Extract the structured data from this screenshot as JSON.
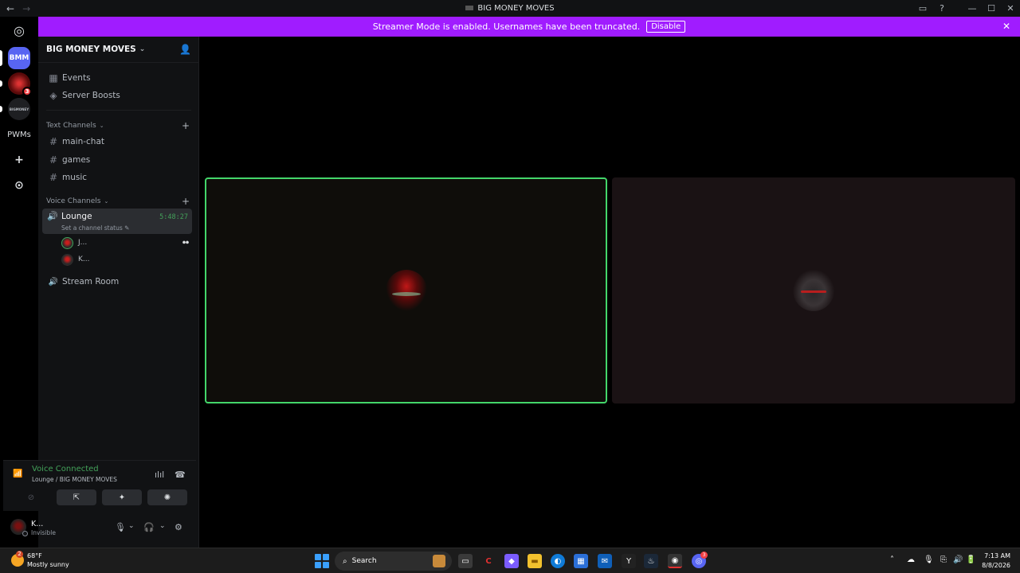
{
  "window": {
    "title": "BIG MONEY MOVES",
    "back_glyph": "←",
    "forward_glyph": "→",
    "minimize_glyph": "—",
    "maximize_glyph": "☐",
    "close_glyph": "✕",
    "inbox_glyph": "▭",
    "help_glyph": "?"
  },
  "servers": {
    "home_glyph": "◎",
    "items": [
      {
        "label": "BMM",
        "color": "#5865f2",
        "badge": ""
      },
      {
        "label": "",
        "color": "#8b1a1a",
        "badge": "3"
      },
      {
        "label": "BIGMONEY",
        "color": "#1e1f22",
        "badge": ""
      },
      {
        "label": "PWMs",
        "color": "#000000",
        "badge": ""
      }
    ],
    "add_glyph": "+",
    "discover_glyph": "⊙"
  },
  "banner": {
    "text": "Streamer Mode is enabled. Usernames have been truncated.",
    "button": "Disable",
    "close_glyph": "✕"
  },
  "sidebar": {
    "server_name": "BIG MONEY MOVES",
    "server_chevron": "⌄",
    "invite_glyph": "👤",
    "top_items": [
      {
        "label": "Events",
        "glyph": "▦"
      },
      {
        "label": "Server Boosts",
        "glyph": "◈"
      }
    ],
    "text_category": "Text Channels",
    "text_channels": [
      "main-chat",
      "games",
      "music"
    ],
    "voice_category": "Voice Channels",
    "plus_glyph": "+",
    "hash_glyph": "#",
    "speaker_glyph": "🔊",
    "active_voice": {
      "name": "Lounge",
      "timer": "5:48:27",
      "status": "Set a channel status ✎"
    },
    "voice_users": [
      {
        "name": "J...",
        "speaking": true,
        "badge": "⏺⏺"
      },
      {
        "name": "K...",
        "speaking": false,
        "badge": ""
      }
    ],
    "other_voice": "Stream Room"
  },
  "voice_panel": {
    "title": "Voice Connected",
    "subtitle": "Lounge / BIG MONEY MOVES",
    "signal_glyph": "📶",
    "noise_glyph": "ılıl",
    "disconnect_glyph": "☎",
    "buttons": [
      {
        "glyph": "⊘",
        "enabled": false
      },
      {
        "glyph": "⇱",
        "enabled": true
      },
      {
        "glyph": "✦",
        "enabled": true
      },
      {
        "glyph": "✺",
        "enabled": true
      }
    ]
  },
  "user": {
    "name": "K...",
    "status": "Invisible",
    "mic_glyph": "🎙",
    "headset_glyph": "🎧",
    "chevron_glyph": "⌄",
    "settings_glyph": "⚙"
  },
  "stage": {
    "tiles": [
      {
        "user": "J...",
        "speaking": true
      },
      {
        "user": "K...",
        "speaking": false
      }
    ]
  },
  "taskbar": {
    "weather_temp": "68°F",
    "weather_badge": "2",
    "weather_condition": "Mostly sunny",
    "search_label": "Search",
    "search_glyph": "⌕",
    "apps": [
      {
        "name": "task-view",
        "glyph": "▭",
        "color": "#3a3a3a"
      },
      {
        "name": "c-app",
        "glyph": "C",
        "color": "#1c1c1c"
      },
      {
        "name": "copilot",
        "glyph": "◆",
        "color": "#7b5cff"
      },
      {
        "name": "file-explorer",
        "glyph": "▬",
        "color": "#f2c12e"
      },
      {
        "name": "edge",
        "glyph": "◐",
        "color": "#0f7bd8"
      },
      {
        "name": "store",
        "glyph": "▦",
        "color": "#2b6fd8"
      },
      {
        "name": "outlook",
        "glyph": "✉",
        "color": "#0f5fb8"
      },
      {
        "name": "yahoo",
        "glyph": "Y",
        "color": "#222222"
      },
      {
        "name": "steam",
        "glyph": "♨",
        "color": "#1b2838"
      },
      {
        "name": "chrome-recording",
        "glyph": "◉",
        "color": "#333333"
      },
      {
        "name": "discord",
        "glyph": "◎",
        "color": "#5865f2"
      }
    ],
    "discord_badge": "3",
    "tray_glyphs": [
      "˄",
      "☁",
      "🎙",
      "⎘",
      "🔊",
      "🔋"
    ],
    "time": "7:13 AM",
    "date": "8/8/2026"
  }
}
